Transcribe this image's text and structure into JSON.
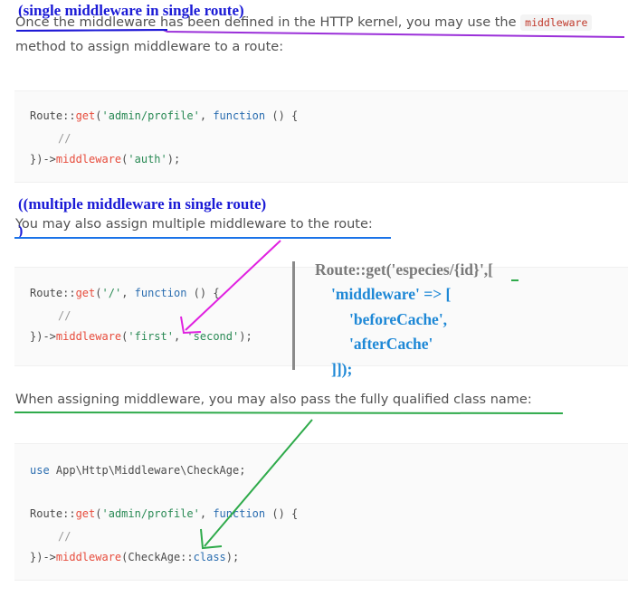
{
  "annotations": {
    "single": "(single middleware in single route)",
    "multiple": "((multiple middleware in single route)",
    "stray_paren": ")"
  },
  "section1": {
    "line1_text": "Once the middleware has been defined in the HTTP kernel, you may use the",
    "inline_code": "middleware",
    "line2_text": "method to assign middleware to a route:",
    "code": {
      "l1_a": "Route::",
      "l1_fn": "get",
      "l1_b": "(",
      "l1_str": "'admin/profile'",
      "l1_c": ", ",
      "l1_kw": "function",
      "l1_d": " () {",
      "l2": "//",
      "l3_a": "})->",
      "l3_fn": "middleware",
      "l3_b": "(",
      "l3_str": "'auth'",
      "l3_c": ");"
    }
  },
  "section2": {
    "text": "You may also assign multiple middleware to the route:",
    "code": {
      "l1_a": "Route::",
      "l1_fn": "get",
      "l1_b": "(",
      "l1_str": "'/'",
      "l1_c": ", ",
      "l1_kw": "function",
      "l1_d": " () {",
      "l2": "//",
      "l3_a": "})->",
      "l3_fn": "middleware",
      "l3_b": "(",
      "l3_str1": "'first'",
      "l3_sep": ", ",
      "l3_str2": "'second'",
      "l3_c": ");"
    },
    "handwritten": {
      "line1": "Route::get('especies/{id}',[",
      "line2": "'middleware' => [",
      "line3": "'beforeCache',",
      "line4": "'afterCache'",
      "line5": "]]);"
    }
  },
  "section3": {
    "text": "When assigning middleware, you may also pass the fully qualified class name:",
    "code": {
      "l1_kw": "use",
      "l1_rest": " App\\Http\\Middleware\\CheckAge;",
      "l2_a": "Route::",
      "l2_fn": "get",
      "l2_b": "(",
      "l2_str": "'admin/profile'",
      "l2_c": ", ",
      "l2_kw": "function",
      "l2_d": " () {",
      "l3": "//",
      "l4_a": "})->",
      "l4_fn": "middleware",
      "l4_b": "(CheckAge::",
      "l4_kw": "class",
      "l4_c": ");"
    }
  },
  "colors": {
    "purple_line": "#9b30d9",
    "blue_line": "#1a73e8",
    "green_line": "#2eaa4a",
    "magenta_arrow": "#e020e0"
  }
}
